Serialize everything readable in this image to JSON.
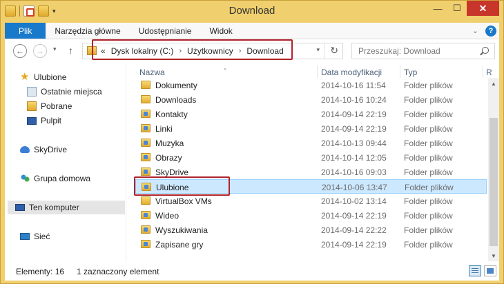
{
  "window": {
    "title": "Download"
  },
  "ribbon": {
    "tabs": [
      "Plik",
      "Narzędzia główne",
      "Udostępnianie",
      "Widok"
    ]
  },
  "address": {
    "overflow": "«",
    "crumbs": [
      "Dysk lokalny (C:)",
      "Użytkownicy",
      "Download"
    ]
  },
  "search": {
    "placeholder": "Przeszukaj: Download"
  },
  "navpane": {
    "favorites": "Ulubione",
    "favorites_items": [
      "Ostatnie miejsca",
      "Pobrane",
      "Pulpit"
    ],
    "skydrive": "SkyDrive",
    "homegroup": "Grupa domowa",
    "computer": "Ten komputer",
    "network": "Sieć"
  },
  "columns": {
    "name": "Nazwa",
    "date": "Data modyfikacji",
    "type": "Typ",
    "size": "R"
  },
  "files": [
    {
      "name": "Dokumenty",
      "date": "2014-10-16 11:54",
      "type": "Folder plików"
    },
    {
      "name": "Downloads",
      "date": "2014-10-16 10:24",
      "type": "Folder plików"
    },
    {
      "name": "Kontakty",
      "date": "2014-09-14 22:19",
      "type": "Folder plików"
    },
    {
      "name": "Linki",
      "date": "2014-09-14 22:19",
      "type": "Folder plików"
    },
    {
      "name": "Muzyka",
      "date": "2014-10-13 09:44",
      "type": "Folder plików"
    },
    {
      "name": "Obrazy",
      "date": "2014-10-14 12:05",
      "type": "Folder plików"
    },
    {
      "name": "SkyDrive",
      "date": "2014-10-16 09:03",
      "type": "Folder plików"
    },
    {
      "name": "Ulubione",
      "date": "2014-10-06 13:47",
      "type": "Folder plików"
    },
    {
      "name": "VirtualBox VMs",
      "date": "2014-10-02 13:14",
      "type": "Folder plików"
    },
    {
      "name": "Wideo",
      "date": "2014-09-14 22:19",
      "type": "Folder plików"
    },
    {
      "name": "Wyszukiwania",
      "date": "2014-09-14 22:22",
      "type": "Folder plików"
    },
    {
      "name": "Zapisane gry",
      "date": "2014-09-14 22:19",
      "type": "Folder plików"
    }
  ],
  "status": {
    "count": "Elementy: 16",
    "selection": "1 zaznaczony element"
  },
  "colors": {
    "accent": "#1979ca",
    "selection": "#cce8ff",
    "highlight_box": "#b0232a",
    "window_frame": "#f0cf6e"
  }
}
